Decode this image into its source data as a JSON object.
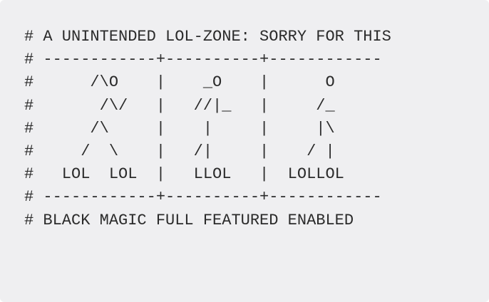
{
  "code_block": {
    "lines": [
      "# A UNINTENDED LOL-ZONE: SORRY FOR THIS",
      "# ------------+----------+------------",
      "#      /\\O    |    _O    |      O",
      "#       /\\/   |   //|_   |     /_",
      "#      /\\     |    |     |     |\\",
      "#     /  \\    |   /|     |    / |",
      "#   LOL  LOL  |   LLOL   |  LOLLOL",
      "# ------------+----------+------------",
      "# BLACK MAGIC FULL FEATURED ENABLED"
    ]
  }
}
